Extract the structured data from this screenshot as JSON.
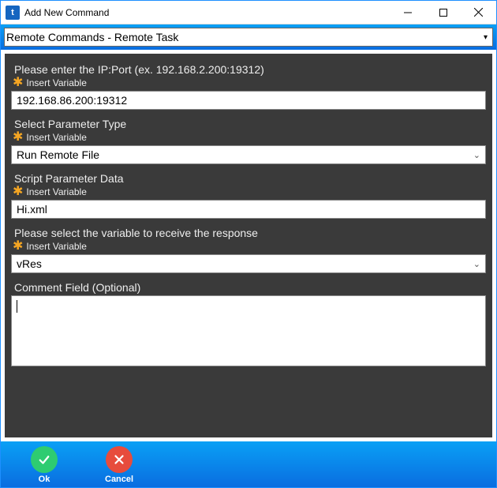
{
  "window": {
    "title": "Add New Command"
  },
  "command_select": {
    "value": "Remote Commands - Remote Task"
  },
  "fields": {
    "ipport": {
      "label": "Please enter the IP:Port (ex. 192.168.2.200:19312)",
      "insert": "Insert Variable",
      "value": "192.168.86.200:19312"
    },
    "param_type": {
      "label": "Select Parameter Type",
      "insert": "Insert Variable",
      "value": "Run Remote File"
    },
    "script_data": {
      "label": "Script Parameter Data",
      "insert": "Insert Variable",
      "value": "Hi.xml"
    },
    "response_var": {
      "label": "Please select the variable to receive the response",
      "insert": "Insert Variable",
      "value": "vRes"
    },
    "comment": {
      "label": "Comment Field (Optional)",
      "value": ""
    }
  },
  "footer": {
    "ok": "Ok",
    "cancel": "Cancel"
  }
}
